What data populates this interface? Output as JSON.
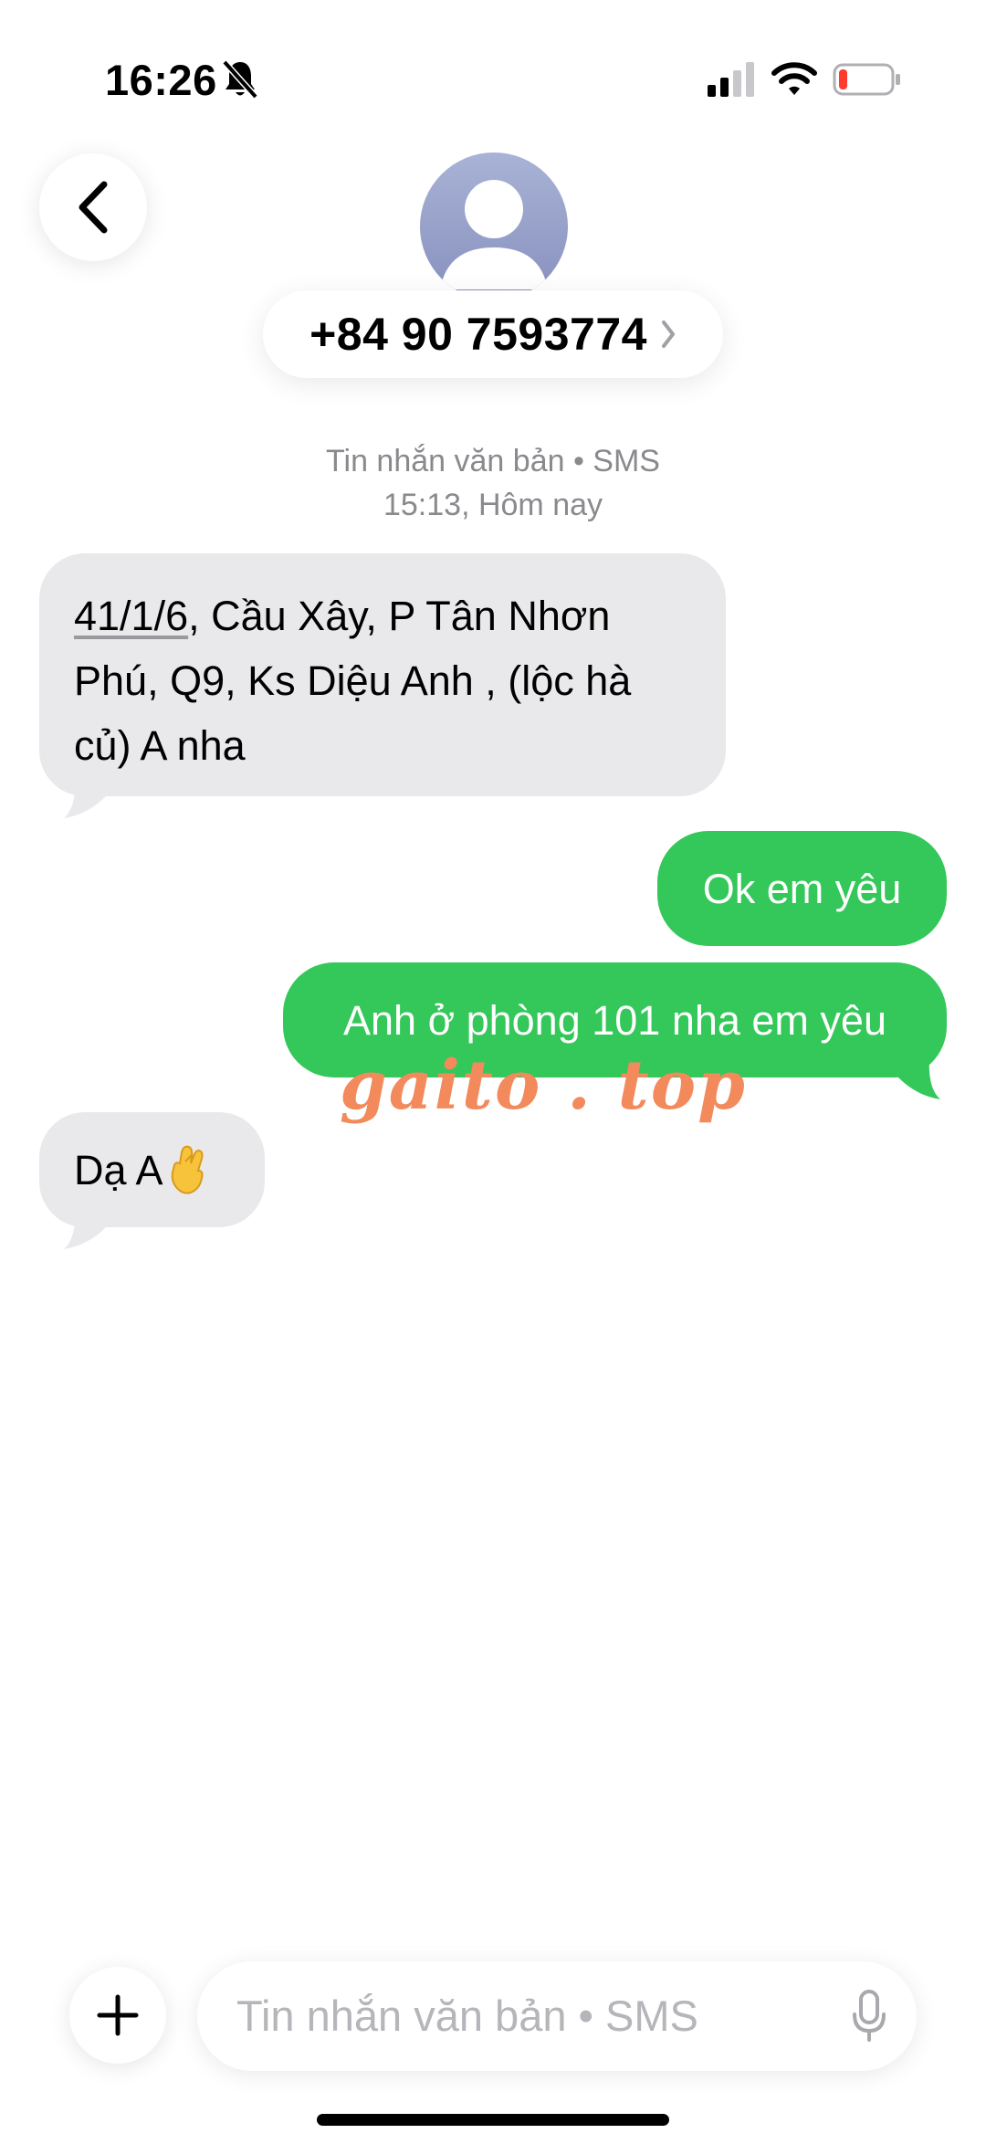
{
  "status_bar": {
    "time": "16:26"
  },
  "header": {
    "contact": "+84 90 7593774"
  },
  "conversation": {
    "meta_line1": "Tin nhắn văn bản • SMS",
    "meta_line2": "15:13, Hôm nay",
    "messages": [
      {
        "direction": "incoming",
        "parts": [
          "41/1/6",
          ", Cầu Xây, P Tân Nhơn",
          "Phú, Q9, Ks Diệu Anh , (lộc hà",
          "củ) A nha"
        ]
      },
      {
        "direction": "outgoing",
        "text": "Ok em yêu"
      },
      {
        "direction": "outgoing",
        "text": "Anh ở phòng 101 nha em yêu"
      },
      {
        "direction": "incoming",
        "text": "Dạ A",
        "emoji": "crossed-fingers"
      }
    ]
  },
  "watermark": "gaito . top",
  "composer": {
    "placeholder": "Tin nhắn văn bản • SMS"
  },
  "colors": {
    "outgoing_bubble": "#34c759",
    "incoming_bubble": "#e9e9eb",
    "watermark": "#f28a5c"
  }
}
